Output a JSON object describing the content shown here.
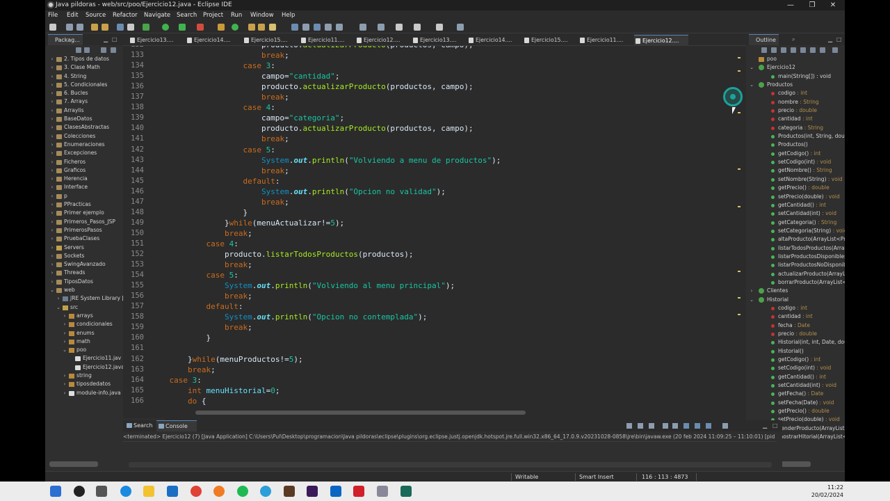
{
  "window": {
    "title": "Java pildoras - web/src/poo/Ejercicio12.java - Eclipse IDE",
    "minimize": "—",
    "restore": "❐",
    "close": "✕"
  },
  "menu": [
    "File",
    "Edit",
    "Source",
    "Refactor",
    "Navigate",
    "Search",
    "Project",
    "Run",
    "Window",
    "Help"
  ],
  "package_explorer": {
    "title": "Packag...",
    "items": [
      {
        "label": "2. Tipos de datos",
        "depth": 0,
        "kind": "proj"
      },
      {
        "label": "3. Clase Math",
        "depth": 0,
        "kind": "proj"
      },
      {
        "label": "4. String",
        "depth": 0,
        "kind": "proj"
      },
      {
        "label": "5. Condicionales",
        "depth": 0,
        "kind": "proj"
      },
      {
        "label": "6. Bucles",
        "depth": 0,
        "kind": "proj"
      },
      {
        "label": "7. Arrays",
        "depth": 0,
        "kind": "proj"
      },
      {
        "label": "Arraylis",
        "depth": 0,
        "kind": "proj"
      },
      {
        "label": "BaseDatos",
        "depth": 0,
        "kind": "proj"
      },
      {
        "label": "ClasesAbstractas",
        "depth": 0,
        "kind": "proj"
      },
      {
        "label": "Colecciones",
        "depth": 0,
        "kind": "proj"
      },
      {
        "label": "Enumeraciones",
        "depth": 0,
        "kind": "proj"
      },
      {
        "label": "Excepciones",
        "depth": 0,
        "kind": "proj"
      },
      {
        "label": "Ficheros",
        "depth": 0,
        "kind": "proj"
      },
      {
        "label": "Graficos",
        "depth": 0,
        "kind": "proj"
      },
      {
        "label": "Herencia",
        "depth": 0,
        "kind": "proj"
      },
      {
        "label": "Interface",
        "depth": 0,
        "kind": "proj"
      },
      {
        "label": "p",
        "depth": 0,
        "kind": "proj"
      },
      {
        "label": "PPracticas",
        "depth": 0,
        "kind": "proj"
      },
      {
        "label": "Primer ejemplo",
        "depth": 0,
        "kind": "proj"
      },
      {
        "label": "Primeros_Pasos_JSP",
        "depth": 0,
        "kind": "proj"
      },
      {
        "label": "PrimerosPasos",
        "depth": 0,
        "kind": "proj"
      },
      {
        "label": "PruebaClases",
        "depth": 0,
        "kind": "proj"
      },
      {
        "label": "Servers",
        "depth": 0,
        "kind": "folder"
      },
      {
        "label": "Sockets",
        "depth": 0,
        "kind": "proj"
      },
      {
        "label": "SwingAvanzado",
        "depth": 0,
        "kind": "proj"
      },
      {
        "label": "Threads",
        "depth": 0,
        "kind": "proj"
      },
      {
        "label": "TiposDatos",
        "depth": 0,
        "kind": "proj"
      },
      {
        "label": "web",
        "depth": 0,
        "kind": "proj",
        "open": true
      },
      {
        "label": "JRE System Library [",
        "depth": 1,
        "kind": "lib"
      },
      {
        "label": "src",
        "depth": 1,
        "kind": "folder",
        "open": true
      },
      {
        "label": "arrays",
        "depth": 2,
        "kind": "pkg"
      },
      {
        "label": "condicionales",
        "depth": 2,
        "kind": "pkg"
      },
      {
        "label": "enums",
        "depth": 2,
        "kind": "pkg"
      },
      {
        "label": "math",
        "depth": 2,
        "kind": "pkg"
      },
      {
        "label": "poo",
        "depth": 2,
        "kind": "pkg",
        "open": true
      },
      {
        "label": "Ejercicio11.jav",
        "depth": 3,
        "kind": "java"
      },
      {
        "label": "Ejercicio12.java",
        "depth": 3,
        "kind": "java"
      },
      {
        "label": "string",
        "depth": 2,
        "kind": "pkg"
      },
      {
        "label": "tiposdedatos",
        "depth": 2,
        "kind": "pkg"
      },
      {
        "label": "module-info.java",
        "depth": 2,
        "kind": "java"
      }
    ]
  },
  "editor": {
    "tabs": [
      "Ejercicio13....",
      "Ejercicio14....",
      "Ejercicio15....",
      "Ejercicio11....",
      "Ejercicio12....",
      "Ejercicio13....",
      "Ejercicio14....",
      "Ejercicio15....",
      "Ejercicio11....",
      "Ejercicio12...."
    ],
    "active_tab": 9,
    "lines": [
      {
        "n": "132",
        "i": 0,
        "h": "                        producto.<m>actualizarProducto</m>(productos, campo);"
      },
      {
        "n": "133",
        "i": 0,
        "h": "                        <k>break</k>;"
      },
      {
        "n": "134",
        "i": 0,
        "h": "                    <k>case</k> <s>3</s>:"
      },
      {
        "n": "135",
        "i": 0,
        "h": "                        campo=<s>\"cantidad\"</s>;"
      },
      {
        "n": "136",
        "i": 0,
        "h": "                        producto.<m>actualizarProducto</m>(productos, campo);"
      },
      {
        "n": "137",
        "i": 0,
        "h": "                        <k>break</k>;"
      },
      {
        "n": "138",
        "i": 0,
        "h": "                    <k>case</k> <s>4</s>:"
      },
      {
        "n": "139",
        "i": 0,
        "h": "                        campo=<s>\"categoria\"</s>;"
      },
      {
        "n": "140",
        "i": 0,
        "h": "                        producto.<m>actualizarProducto</m>(productos, campo);"
      },
      {
        "n": "141",
        "i": 0,
        "h": "                        <k>break</k>;"
      },
      {
        "n": "142",
        "i": 0,
        "h": "                    <k>case</k> <s>5</s>:"
      },
      {
        "n": "143",
        "i": 0,
        "h": "                        <sys>System</sys>.<f>out</f>.<m>println</m>(<s>\"Volviendo a menu de productos\"</s>);"
      },
      {
        "n": "144",
        "i": 0,
        "h": "                        <k>break</k>;"
      },
      {
        "n": "145",
        "i": 0,
        "h": "                    <k>default</k>:"
      },
      {
        "n": "146",
        "i": 0,
        "h": "                        <sys>System</sys>.<f>out</f>.<m>println</m>(<s>\"Opcion no validad\"</s>);"
      },
      {
        "n": "147",
        "i": 0,
        "h": "                        <k>break</k>;"
      },
      {
        "n": "148",
        "i": 0,
        "h": "                    }"
      },
      {
        "n": "149",
        "i": 0,
        "h": "                }<k>while</k>(menuActualizar!=<s>5</s>);"
      },
      {
        "n": "150",
        "i": 0,
        "h": "                <k>break</k>;"
      },
      {
        "n": "151",
        "i": 0,
        "h": "            <k>case</k> <s>4</s>:"
      },
      {
        "n": "152",
        "i": 0,
        "h": "                producto.<m>listarTodosProductos</m>(productos);"
      },
      {
        "n": "153",
        "i": 0,
        "h": "                <k>break</k>;"
      },
      {
        "n": "154",
        "i": 0,
        "h": "            <k>case</k> <s>5</s>:"
      },
      {
        "n": "155",
        "i": 0,
        "h": "                <sys>System</sys>.<f>out</f>.<m>println</m>(<s>\"Volviendo al menu principal\"</s>);"
      },
      {
        "n": "156",
        "i": 0,
        "h": "                <k>break</k>;"
      },
      {
        "n": "157",
        "i": 0,
        "h": "            <k>default</k>:"
      },
      {
        "n": "158",
        "i": 0,
        "h": "                <sys>System</sys>.<f>out</f>.<m>println</m>(<s>\"Opcion no contemplada\"</s>);"
      },
      {
        "n": "159",
        "i": 0,
        "h": "                <k>break</k>;"
      },
      {
        "n": "160",
        "i": 0,
        "h": "            }"
      },
      {
        "n": "161",
        "i": 0,
        "h": ""
      },
      {
        "n": "162",
        "i": 0,
        "h": "        }<k>while</k>(menuProductos!=<s>5</s>);"
      },
      {
        "n": "163",
        "i": 0,
        "h": "        <k>break</k>;"
      },
      {
        "n": "164",
        "i": 0,
        "h": "    <k>case</k> <s>3</s>:"
      },
      {
        "n": "165",
        "i": 0,
        "h": "        <k>int</k> <v>menuHistorial</v>=<s>0</s>;"
      },
      {
        "n": "166",
        "i": 0,
        "h": "        <k>do</k> {"
      }
    ]
  },
  "outline": {
    "title": "Outline",
    "items": [
      {
        "label": "poo",
        "type": "",
        "depth": 0,
        "kind": "pkgi"
      },
      {
        "label": "Ejercicio12",
        "type": "",
        "depth": 0,
        "kind": "cls",
        "open": true
      },
      {
        "label": "main(String[]) : void",
        "type": "",
        "depth": 1,
        "kind": "pub"
      },
      {
        "label": "Productos",
        "type": "",
        "depth": 0,
        "kind": "cls",
        "open": true
      },
      {
        "label": "codigo",
        "type": " : int",
        "depth": 1,
        "kind": "priv"
      },
      {
        "label": "nombre",
        "type": " : String",
        "depth": 1,
        "kind": "priv"
      },
      {
        "label": "precio",
        "type": " : double",
        "depth": 1,
        "kind": "priv"
      },
      {
        "label": "cantidad",
        "type": " : int",
        "depth": 1,
        "kind": "priv"
      },
      {
        "label": "categoria",
        "type": " : String",
        "depth": 1,
        "kind": "priv"
      },
      {
        "label": "Productos(int, String, doub",
        "type": "",
        "depth": 1,
        "kind": "pub"
      },
      {
        "label": "Productos()",
        "type": "",
        "depth": 1,
        "kind": "pub"
      },
      {
        "label": "getCodigo()",
        "type": " : int",
        "depth": 1,
        "kind": "pub"
      },
      {
        "label": "setCodigo(int)",
        "type": " : void",
        "depth": 1,
        "kind": "pub"
      },
      {
        "label": "getNombre()",
        "type": " : String",
        "depth": 1,
        "kind": "pub"
      },
      {
        "label": "setNombre(String)",
        "type": " : void",
        "depth": 1,
        "kind": "pub"
      },
      {
        "label": "getPrecio()",
        "type": " : double",
        "depth": 1,
        "kind": "pub"
      },
      {
        "label": "setPrecio(double)",
        "type": " : void",
        "depth": 1,
        "kind": "pub"
      },
      {
        "label": "getCantidad()",
        "type": " : int",
        "depth": 1,
        "kind": "pub"
      },
      {
        "label": "setCantidad(int)",
        "type": " : void",
        "depth": 1,
        "kind": "pub"
      },
      {
        "label": "getCategoria()",
        "type": " : String",
        "depth": 1,
        "kind": "pub"
      },
      {
        "label": "setCategoria(String)",
        "type": " : void",
        "depth": 1,
        "kind": "pub"
      },
      {
        "label": "altaProducto(ArrayList<Pro",
        "type": "",
        "depth": 1,
        "kind": "pub"
      },
      {
        "label": "listarTodosProductos(Array",
        "type": "",
        "depth": 1,
        "kind": "pub"
      },
      {
        "label": "listarProductosDisponibles",
        "type": "",
        "depth": 1,
        "kind": "pub"
      },
      {
        "label": "listarProductosNoDisponib",
        "type": "",
        "depth": 1,
        "kind": "pub"
      },
      {
        "label": "actualizarProducto(ArrayLi",
        "type": "",
        "depth": 1,
        "kind": "pub"
      },
      {
        "label": "borrarProducto(ArrayList<",
        "type": "",
        "depth": 1,
        "kind": "pub"
      },
      {
        "label": "Clientes",
        "type": "",
        "depth": 0,
        "kind": "cls"
      },
      {
        "label": "Historial",
        "type": "",
        "depth": 0,
        "kind": "cls",
        "open": true
      },
      {
        "label": "codigo",
        "type": " : int",
        "depth": 1,
        "kind": "priv"
      },
      {
        "label": "cantidad",
        "type": " : int",
        "depth": 1,
        "kind": "priv"
      },
      {
        "label": "fecha",
        "type": " : Date",
        "depth": 1,
        "kind": "priv"
      },
      {
        "label": "precio",
        "type": " : double",
        "depth": 1,
        "kind": "priv"
      },
      {
        "label": "Historial(int, int, Date, dou",
        "type": "",
        "depth": 1,
        "kind": "pub"
      },
      {
        "label": "Historial()",
        "type": "",
        "depth": 1,
        "kind": "pub"
      },
      {
        "label": "getCodigo()",
        "type": " : int",
        "depth": 1,
        "kind": "pub"
      },
      {
        "label": "setCodigo(int)",
        "type": " : void",
        "depth": 1,
        "kind": "pub"
      },
      {
        "label": "getCantidad()",
        "type": " : int",
        "depth": 1,
        "kind": "pub"
      },
      {
        "label": "setCantidad(int)",
        "type": " : void",
        "depth": 1,
        "kind": "pub"
      },
      {
        "label": "getFecha()",
        "type": " : Date",
        "depth": 1,
        "kind": "pub"
      },
      {
        "label": "setFecha(Date)",
        "type": " : void",
        "depth": 1,
        "kind": "pub"
      },
      {
        "label": "getPrecio()",
        "type": " : double",
        "depth": 1,
        "kind": "pub"
      },
      {
        "label": "setPrecio(double)",
        "type": " : void",
        "depth": 1,
        "kind": "pub"
      },
      {
        "label": "venderProducto(ArrayList<",
        "type": "",
        "depth": 1,
        "kind": "pub"
      },
      {
        "label": "mostrarHitorial(ArrayList<",
        "type": "",
        "depth": 1,
        "kind": "pub"
      }
    ]
  },
  "console": {
    "tabs": [
      "Search",
      "Console"
    ],
    "terminated_text": "<terminated> Ejercicio12 (7) [Java Application] C:\\Users\\Pul\\Desktop\\programacion\\Java pildoras\\eclipse\\plugins\\org.eclipse.justj.openjdk.hotspot.jre.full.win32.x86_64_17.0.9.v20231028-0858\\jre\\bin\\javaw.exe  (20 feb 2024 11:09:25 – 11:10:01) [pid"
  },
  "status": {
    "writable": "Writable",
    "insert_mode": "Smart Insert",
    "position": "116 : 113 : 4873"
  },
  "taskbar": {
    "time": "11:22",
    "date": "20/02/2024"
  },
  "colors": {
    "keyword": "#cc6c1d",
    "string": "#17c6a3",
    "method": "#a7ec21",
    "accent": "#5a87b8"
  }
}
